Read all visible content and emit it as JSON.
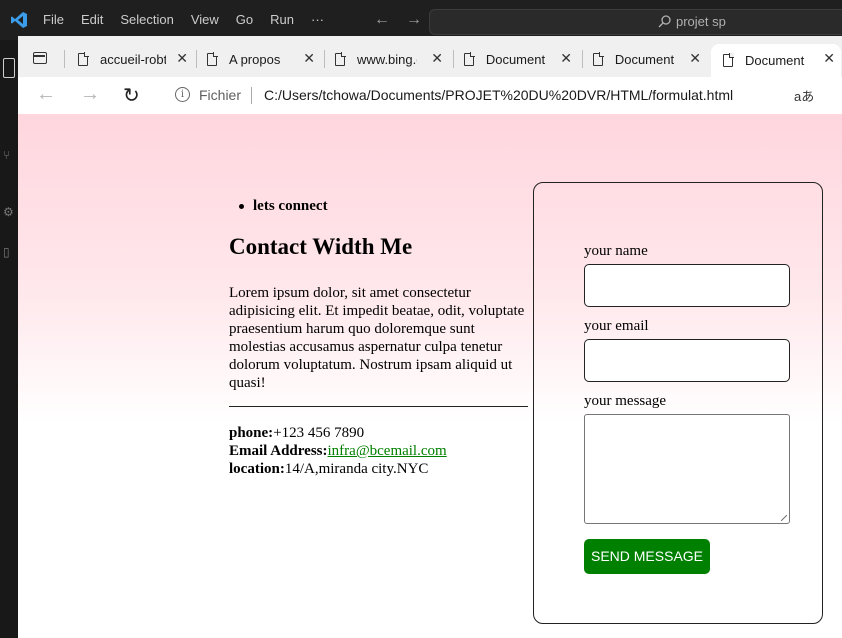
{
  "vscode": {
    "menu": [
      "File",
      "Edit",
      "Selection",
      "View",
      "Go",
      "Run",
      "···"
    ],
    "search": "projet sp"
  },
  "browser": {
    "tabs": [
      {
        "label": "accueil-robt"
      },
      {
        "label": "A propos"
      },
      {
        "label": "www.bing.com"
      },
      {
        "label": "Document"
      },
      {
        "label": "Document"
      },
      {
        "label": "Document"
      }
    ],
    "address": {
      "scheme_label": "Fichier",
      "url": "C:/Users/tchowa/Documents/PROJET%20DU%20DVR/HTML/formulat.html",
      "read_aloud": "aあ"
    }
  },
  "page": {
    "list_item": "lets connect",
    "heading": "Contact Width Me",
    "lorem": "Lorem ipsum dolor, sit amet consectetur adipisicing elit. Et impedit beatae, odit, voluptate praesentium harum quo doloremque sunt molestias accusamus aspernatur culpa tenetur dolorum voluptatum. Nostrum ipsam aliquid ut quasi!",
    "phone_label": "phone:",
    "phone": "+123 456 7890",
    "email_label": "Email Address:",
    "email": "infra@bcemail.com",
    "location_label": "location:",
    "location": "14/A,miranda city.NYC",
    "form": {
      "name_label": "your name",
      "email_label": "your email",
      "message_label": "your message",
      "send": "SEND MESSAGE"
    }
  },
  "colors": {
    "send_button": "#008000",
    "page_gradient_top": "#ffd6de"
  }
}
